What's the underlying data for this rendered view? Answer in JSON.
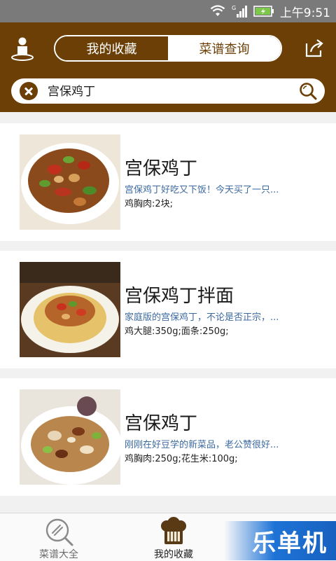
{
  "status_bar": {
    "time": "上午9:51",
    "signal_label": "G"
  },
  "header": {
    "tabs": [
      {
        "label": "我的收藏",
        "active": false
      },
      {
        "label": "菜谱查询",
        "active": true
      }
    ],
    "search": {
      "value": "宫保鸡丁"
    }
  },
  "results": [
    {
      "title": "宫保鸡丁",
      "description": "宫保鸡丁好吃又下饭！今天买了一只...",
      "ingredients": "鸡胸肉:2块;"
    },
    {
      "title": "宫保鸡丁拌面",
      "description": "家庭版的宫保鸡丁，不论是否正宗，...",
      "ingredients": "鸡大腿:350g;面条:250g;"
    },
    {
      "title": "宫保鸡丁",
      "description": "刚刚在好豆学的新菜品，老公赞很好...",
      "ingredients": "鸡胸肉:250g;花生米:100g;"
    }
  ],
  "bottom_nav": [
    {
      "label": "菜谱大全",
      "icon": "search-icon",
      "active": false
    },
    {
      "label": "我的收藏",
      "icon": "chef-hat-icon",
      "active": true
    }
  ],
  "watermark": {
    "text": "乐单机"
  },
  "colors": {
    "brand_brown": "#6b3f05",
    "link_blue": "#3c6aa0"
  }
}
